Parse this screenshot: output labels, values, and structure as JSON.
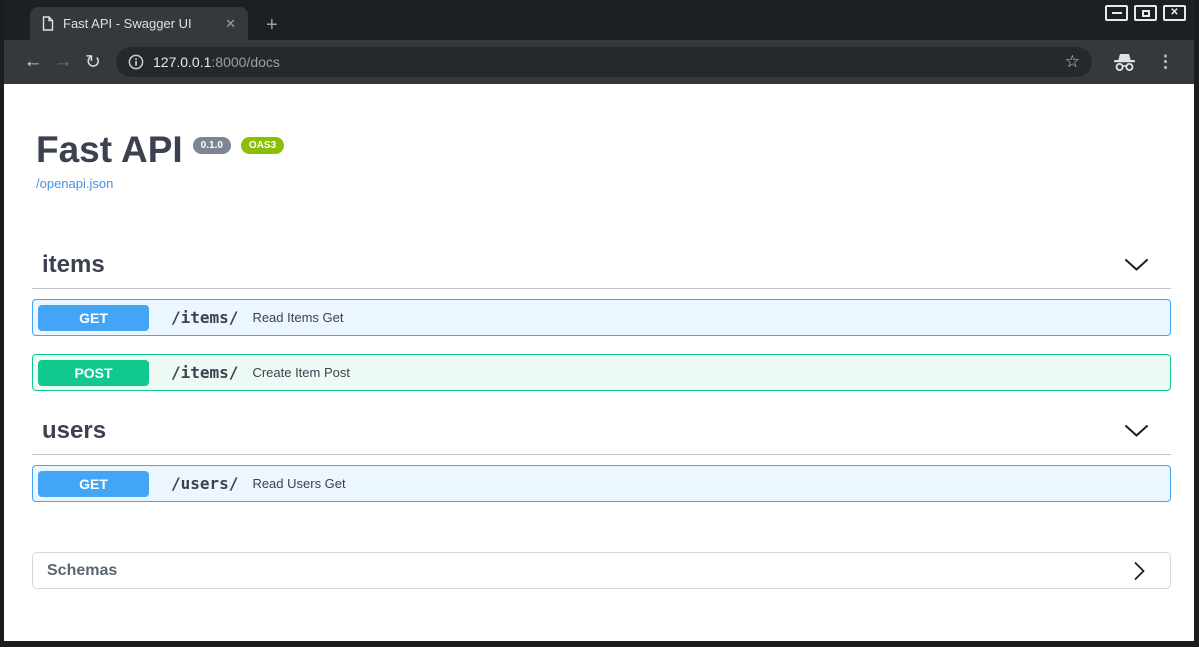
{
  "window_controls": {
    "close_icon": "✕"
  },
  "browser": {
    "tab_title": "Fast API - Swagger UI",
    "tab_close_icon": "✕",
    "new_tab_icon": "+",
    "nav": {
      "back_icon": "←",
      "forward_icon": "→",
      "reload_icon": "↻"
    },
    "omnibox": {
      "host": "127.0.0.1",
      "rest": ":8000/docs",
      "bookmark_icon": "☆"
    },
    "menu_icon": "⋮"
  },
  "content": {
    "api_title": "Fast API",
    "version_badge": "0.1.0",
    "oas_badge": "OAS3",
    "spec_link": "/openapi.json",
    "sections": [
      {
        "name": "items",
        "operations": [
          {
            "method": "GET",
            "path": "/items/",
            "summary": "Read Items Get"
          },
          {
            "method": "POST",
            "path": "/items/",
            "summary": "Create Item Post"
          }
        ]
      },
      {
        "name": "users",
        "operations": [
          {
            "method": "GET",
            "path": "/users/",
            "summary": "Read Users Get"
          }
        ]
      }
    ],
    "schemas_label": "Schemas"
  },
  "colors": {
    "get_method": "#42a5f5",
    "get_row_bg": "#ecf6fe",
    "post_method": "#11c98f",
    "post_row_bg": "#edfaf4",
    "link": "#4990e2",
    "heading": "#3b4151",
    "version_badge_bg": "#7d8492",
    "oas_badge_bg": "#89bf04",
    "titlebar_bg": "#1d2022",
    "toolbar_bg": "#35393c",
    "omnibox_bg": "#26292b"
  }
}
